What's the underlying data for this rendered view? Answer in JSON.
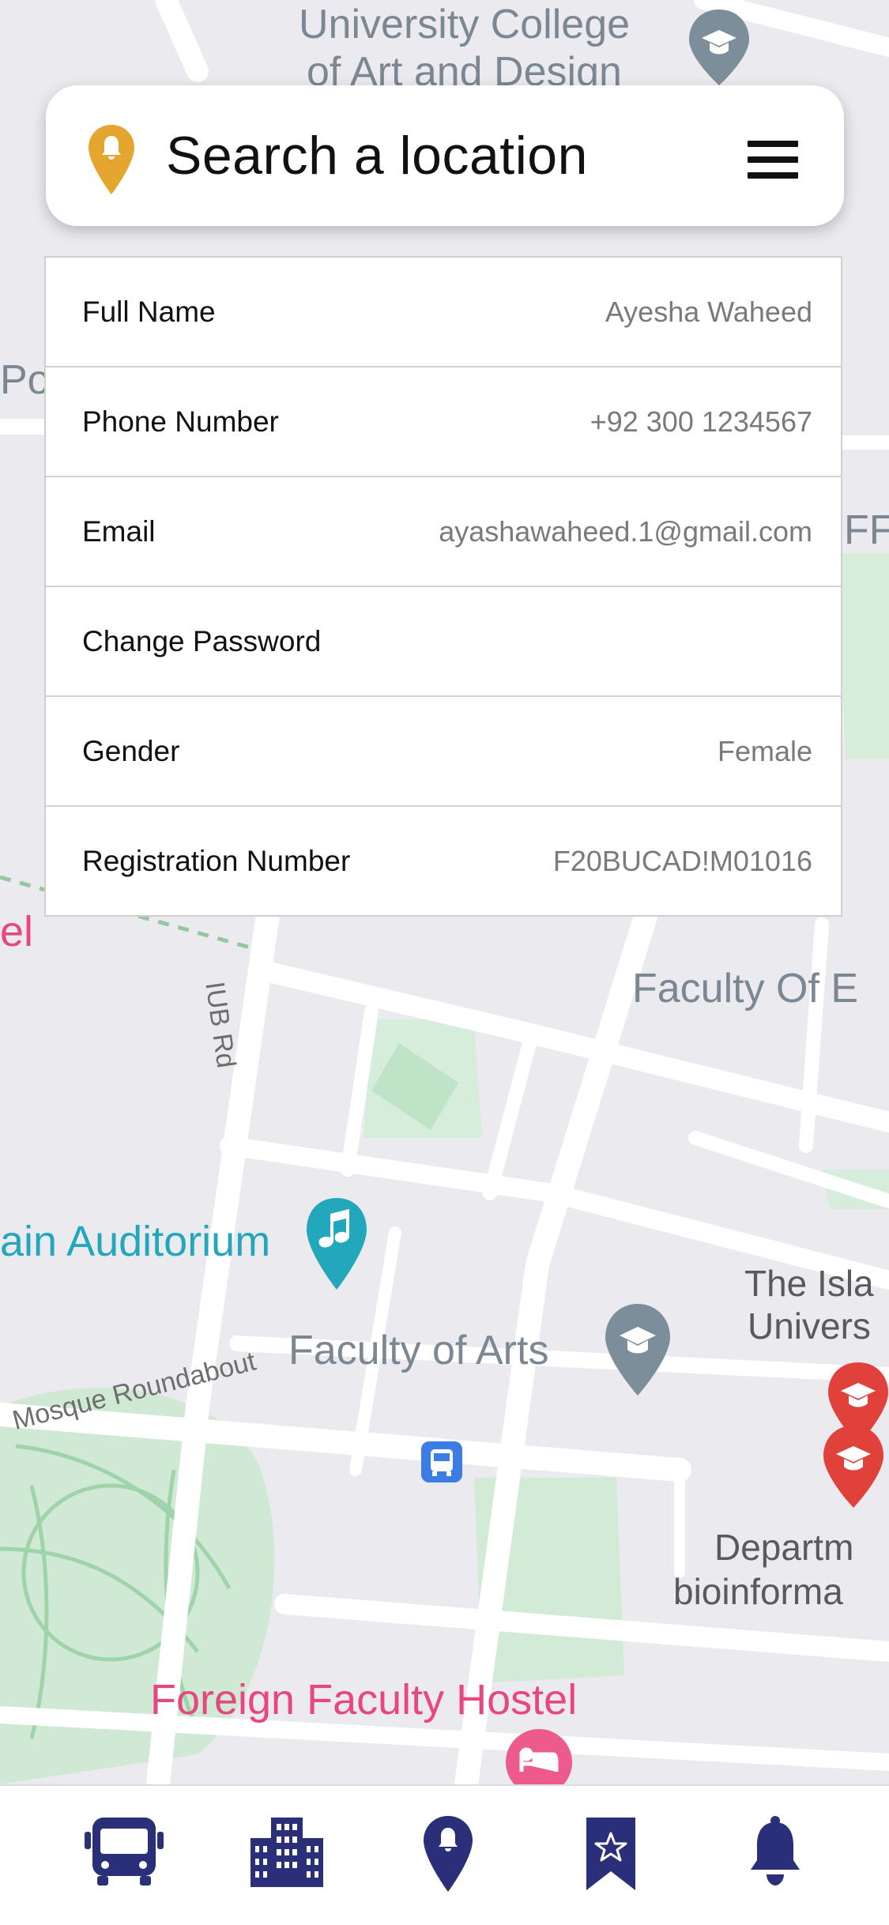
{
  "search": {
    "placeholder": "Search a location",
    "pin_icon": "location-pin-icon",
    "pin_color": "#e4a62e",
    "menu_icon": "hamburger-menu-icon"
  },
  "profile": {
    "rows": [
      {
        "label": "Full Name",
        "value": "Ayesha Waheed"
      },
      {
        "label": "Phone Number",
        "value": "+92 300 1234567"
      },
      {
        "label": "Email",
        "value": "ayashawaheed.1@gmail.com"
      },
      {
        "label": "Change Password",
        "value": ""
      },
      {
        "label": "Gender",
        "value": "Female"
      },
      {
        "label": "Registration Number",
        "value": "F20BUCAD!M01016"
      }
    ]
  },
  "map": {
    "labels": {
      "university_college_1": "University College",
      "university_college_2": "of Art and Design",
      "po_partial": "Po",
      "off_partial": "FF",
      "el_partial": "el",
      "iub_rd": "IUB Rd",
      "faculty_of_e": "Faculty Of E",
      "main_auditorium": "ain Auditorium",
      "faculty_of_arts": "Faculty of Arts",
      "the_isla": "The Isla",
      "univers": "Univers",
      "mosque_roundabout": "Mosque Roundabout",
      "departm": "Departm",
      "bioinforma": "bioinforma",
      "foreign_faculty_hostel": "Foreign Faculty Hostel"
    }
  },
  "bottom_nav": {
    "items": [
      {
        "name": "bus",
        "icon": "bus-icon"
      },
      {
        "name": "buildings",
        "icon": "building-icon"
      },
      {
        "name": "location",
        "icon": "location-pin-icon"
      },
      {
        "name": "bookmark",
        "icon": "bookmark-star-icon"
      },
      {
        "name": "notifications",
        "icon": "bell-icon"
      }
    ],
    "color": "#2b2f7a"
  }
}
